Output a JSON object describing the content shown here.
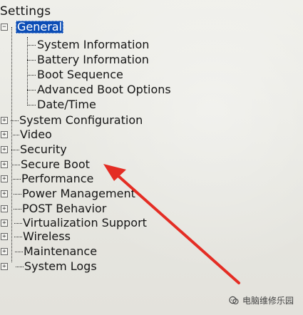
{
  "settings": {
    "title": "Settings",
    "general": {
      "label": "General",
      "toggle": "−",
      "children": [
        "System Information",
        "Battery Information",
        "Boot Sequence",
        "Advanced Boot Options",
        "Date/Time"
      ]
    },
    "items": [
      {
        "label": "System Configuration",
        "toggle": "+"
      },
      {
        "label": "Video",
        "toggle": "+"
      },
      {
        "label": "Security",
        "toggle": "+"
      },
      {
        "label": "Secure Boot",
        "toggle": "+"
      },
      {
        "label": "Performance",
        "toggle": "+"
      },
      {
        "label": "Power Management",
        "toggle": "+"
      },
      {
        "label": "POST Behavior",
        "toggle": "+"
      },
      {
        "label": "Virtualization Support",
        "toggle": "+"
      },
      {
        "label": "Wireless",
        "toggle": "+"
      },
      {
        "label": "Maintenance",
        "toggle": "+"
      },
      {
        "label": "System Logs",
        "toggle": "+"
      }
    ]
  },
  "overlay": {
    "arrow_color": "#e42d24",
    "watermark_text": "电脑维修乐园",
    "watermark_icon": "chat-bubble-icon"
  },
  "colors": {
    "selection": "#0b4db6",
    "background": "#e9e9e4"
  }
}
